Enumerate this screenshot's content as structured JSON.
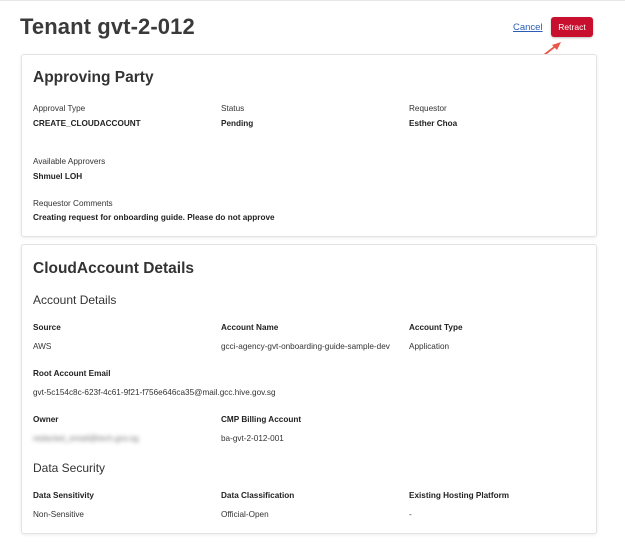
{
  "header": {
    "title": "Tenant gvt-2-012",
    "cancel_label": "Cancel",
    "retract_label": "Retract"
  },
  "approving": {
    "title": "Approving Party",
    "approval_type_label": "Approval Type",
    "approval_type_value": "CREATE_CLOUDACCOUNT",
    "status_label": "Status",
    "status_value": "Pending",
    "requestor_label": "Requestor",
    "requestor_value": "Esther Choa",
    "approvers_label": "Available Approvers",
    "approvers_value": "Shmuel LOH",
    "comments_label": "Requestor Comments",
    "comments_value": "Creating request for onboarding guide. Please do not approve"
  },
  "details": {
    "title": "CloudAccount Details",
    "account_section": "Account Details",
    "source_label": "Source",
    "source_value": "AWS",
    "account_name_label": "Account Name",
    "account_name_value": "gcci-agency-gvt-onboarding-guide-sample-dev",
    "account_type_label": "Account Type",
    "account_type_value": "Application",
    "root_email_label": "Root Account Email",
    "root_email_value": "gvt-5c154c8c-623f-4c61-9f21-f756e646ca35@mail.gcc.hive.gov.sg",
    "owner_label": "Owner",
    "owner_value": "redacted_email@tech.gov.sg",
    "billing_label": "CMP Billing Account",
    "billing_value": "ba-gvt-2-012-001",
    "security_section": "Data Security",
    "sensitivity_label": "Data Sensitivity",
    "sensitivity_value": "Non-Sensitive",
    "classification_label": "Data Classification",
    "classification_value": "Official-Open",
    "hosting_label": "Existing Hosting Platform",
    "hosting_value": "-"
  },
  "colors": {
    "accent": "#c8102e",
    "link": "#2a5db8",
    "annotation_arrow": "#e8574a"
  },
  "icons": {
    "annotation": "arrow-pointer-icon"
  }
}
